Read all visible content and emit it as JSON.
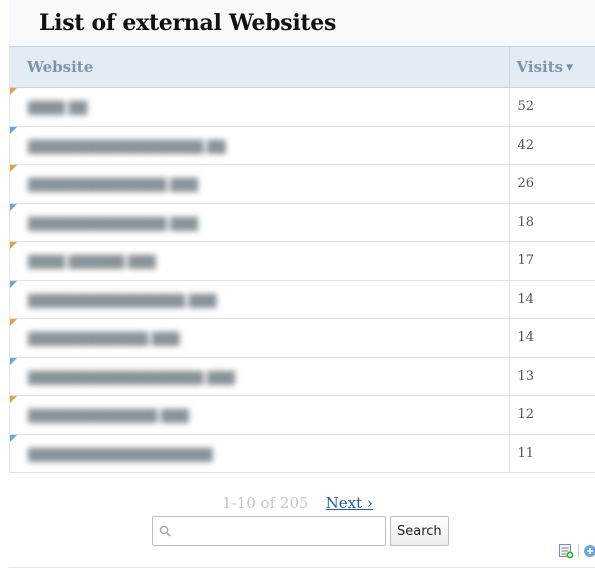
{
  "widget": {
    "title": "List of external Websites",
    "columns": {
      "website": "Website",
      "visits": "Visits"
    },
    "rows": [
      {
        "website": "████ ██",
        "visits": "52",
        "marker": "orange"
      },
      {
        "website": "███████████████████.██",
        "visits": "42",
        "marker": "blue"
      },
      {
        "website": "███████████████.███",
        "visits": "26",
        "marker": "orange"
      },
      {
        "website": "███████████████.███",
        "visits": "18",
        "marker": "blue"
      },
      {
        "website": "████.██████.███",
        "visits": "17",
        "marker": "orange"
      },
      {
        "website": "█████████████████.███",
        "visits": "14",
        "marker": "blue"
      },
      {
        "website": "█████████████.███",
        "visits": "14",
        "marker": "orange"
      },
      {
        "website": "███████████████████.███",
        "visits": "13",
        "marker": "blue"
      },
      {
        "website": "██████████████.███",
        "visits": "12",
        "marker": "orange"
      },
      {
        "website": "████████████████████",
        "visits": "11",
        "marker": "blue"
      }
    ]
  },
  "pager": {
    "range": "1-10 of 205",
    "next": "Next ›"
  },
  "search": {
    "placeholder": "",
    "button": "Search"
  },
  "footer": {
    "icons": [
      "export-icon",
      "add-icon"
    ]
  },
  "colors": {
    "marker_orange": "#e0a24a",
    "marker_blue": "#6fa6d8",
    "header_bg": "#e3ecf4",
    "link": "#2a57a8"
  }
}
